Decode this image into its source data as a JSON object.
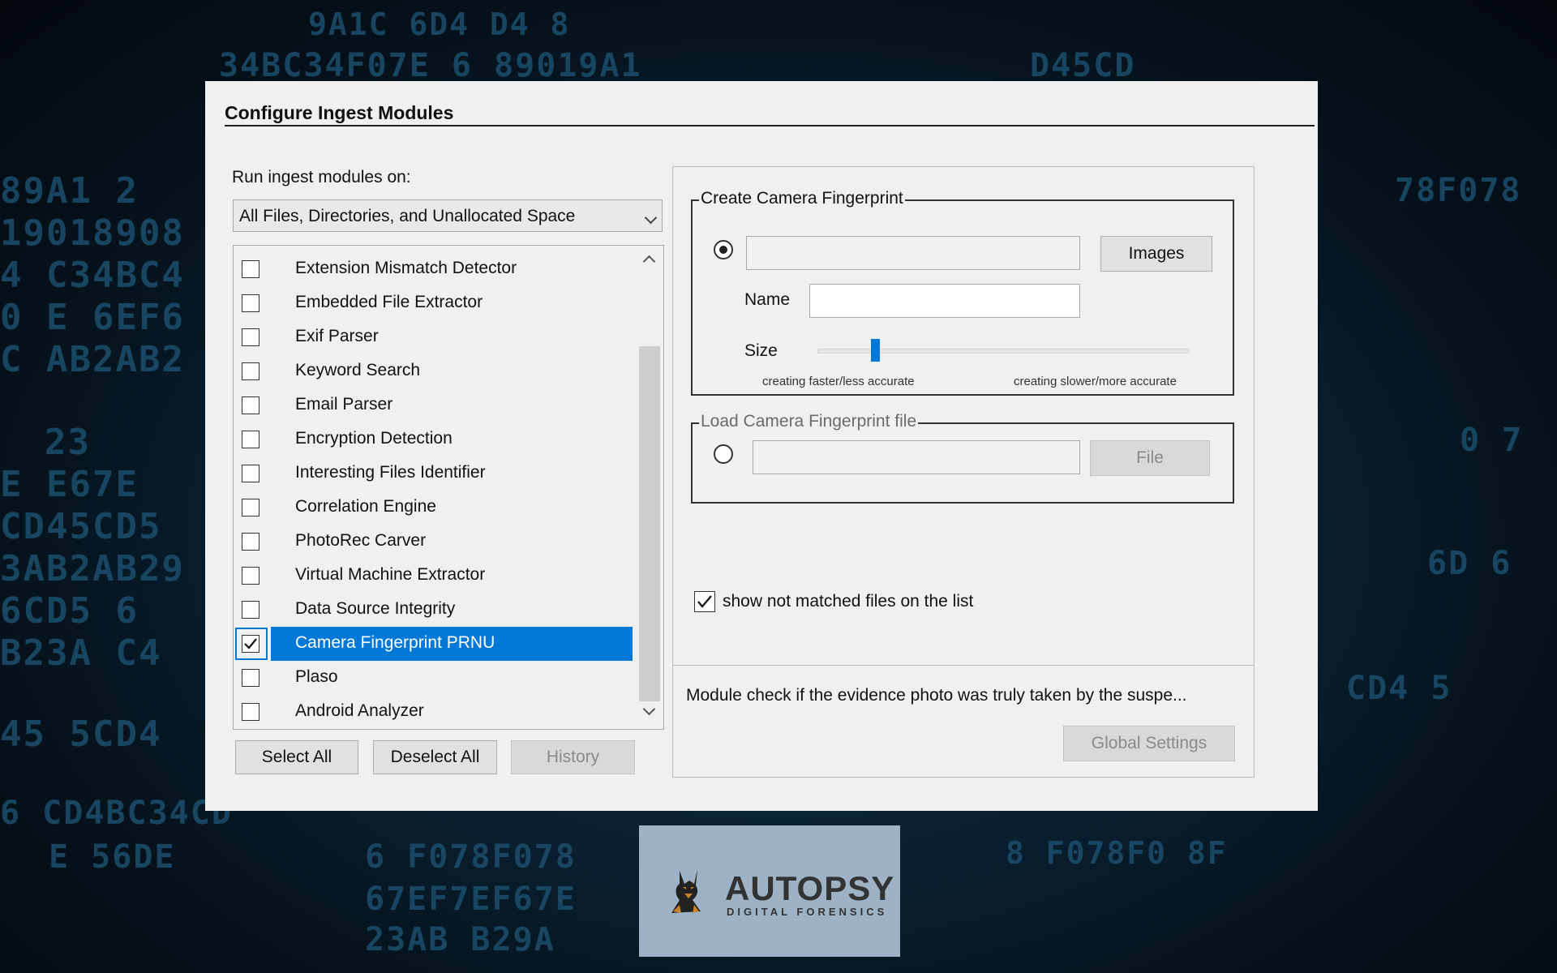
{
  "dialog": {
    "title": "Configure Ingest Modules",
    "run_label": "Run ingest modules on:",
    "run_target": "All Files, Directories, and Unallocated Space",
    "modules": [
      {
        "label": "Extension Mismatch Detector",
        "checked": false,
        "selected": false
      },
      {
        "label": "Embedded File Extractor",
        "checked": false,
        "selected": false
      },
      {
        "label": "Exif Parser",
        "checked": false,
        "selected": false
      },
      {
        "label": "Keyword Search",
        "checked": false,
        "selected": false
      },
      {
        "label": "Email Parser",
        "checked": false,
        "selected": false
      },
      {
        "label": "Encryption Detection",
        "checked": false,
        "selected": false
      },
      {
        "label": "Interesting Files Identifier",
        "checked": false,
        "selected": false
      },
      {
        "label": "Correlation Engine",
        "checked": false,
        "selected": false
      },
      {
        "label": "PhotoRec Carver",
        "checked": false,
        "selected": false
      },
      {
        "label": "Virtual Machine Extractor",
        "checked": false,
        "selected": false
      },
      {
        "label": "Data Source Integrity",
        "checked": false,
        "selected": false
      },
      {
        "label": "Camera Fingerprint PRNU",
        "checked": true,
        "selected": true
      },
      {
        "label": "Plaso",
        "checked": false,
        "selected": false
      },
      {
        "label": "Android Analyzer",
        "checked": false,
        "selected": false
      }
    ],
    "buttons": {
      "select_all": "Select All",
      "deselect_all": "Deselect All",
      "history": "History"
    },
    "settings": {
      "create_group": {
        "legend": "Create Camera Fingerprint",
        "images_button": "Images",
        "name_label": "Name",
        "name_value": "",
        "size_label": "Size",
        "size_level": 0.15,
        "hint_left": "creating faster/less accurate",
        "hint_right": "creating slower/more accurate",
        "selected": true
      },
      "load_group": {
        "legend": "Load Camera Fingerprint file",
        "file_button": "File",
        "selected": false
      },
      "show_not_matched": {
        "label": "show not matched files on the list",
        "checked": true
      },
      "description": "Module check if the evidence photo was truly taken by the suspe...",
      "global_settings_button": "Global Settings"
    },
    "colors": {
      "selection": "#0078d7",
      "dialog_bg": "#f0f0f0"
    }
  },
  "logo": {
    "title": "AUTOPSY",
    "subtitle": "DIGITAL FORENSICS",
    "icon": "doberman-dog-icon"
  },
  "background": {
    "hex_lines": [
      "9A1C  6D4  D4  8",
      "34BC34F07E  6 89019A1",
      "D45CD",
      "89A1 2",
      "19018908",
      "4 C34BC4",
      "0 E  6EF6",
      "C AB2AB2",
      "23",
      "E E67E",
      "CD45CD5",
      "3AB2AB29",
      "6CD5 6",
      "B23A C4",
      "45 5CD4",
      "6 CD4BC34CD",
      "E 56DE",
      "6 F078F078",
      "67EF7EF67E",
      "23AB B29A",
      "78F078",
      "0 7",
      "6D 6",
      "CD4 5",
      "8 F078F0 8F"
    ]
  }
}
